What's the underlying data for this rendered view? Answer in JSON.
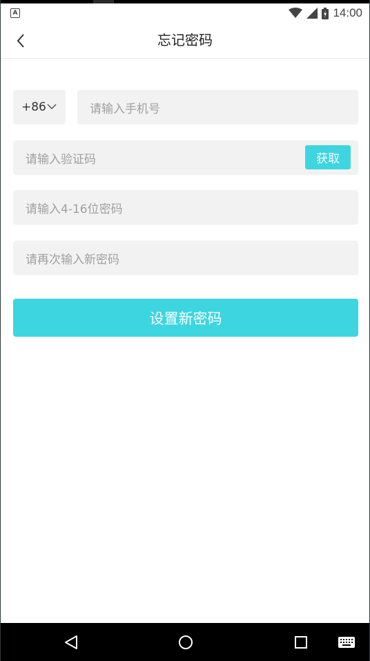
{
  "status_bar": {
    "time": "14:00",
    "notification_icon": "a-icon",
    "notification_letter": "A",
    "icons": [
      "wifi-icon",
      "signal-icon",
      "battery-icon"
    ]
  },
  "header": {
    "title": "忘记密码",
    "back_icon": "chevron-left-icon"
  },
  "form": {
    "country_code": "+86",
    "phone_placeholder": "请输入手机号",
    "code_placeholder": "请输入验证码",
    "get_code_label": "获取",
    "password_placeholder": "请输入4-16位密码",
    "confirm_password_placeholder": "请再次输入新密码",
    "submit_label": "设置新密码"
  },
  "colors": {
    "accent": "#3dd6e0",
    "field_bg": "#f2f2f2",
    "placeholder": "#a0a0a0"
  },
  "system_nav": [
    "back-triangle-icon",
    "home-circle-icon",
    "recents-square-icon",
    "keyboard-icon"
  ]
}
